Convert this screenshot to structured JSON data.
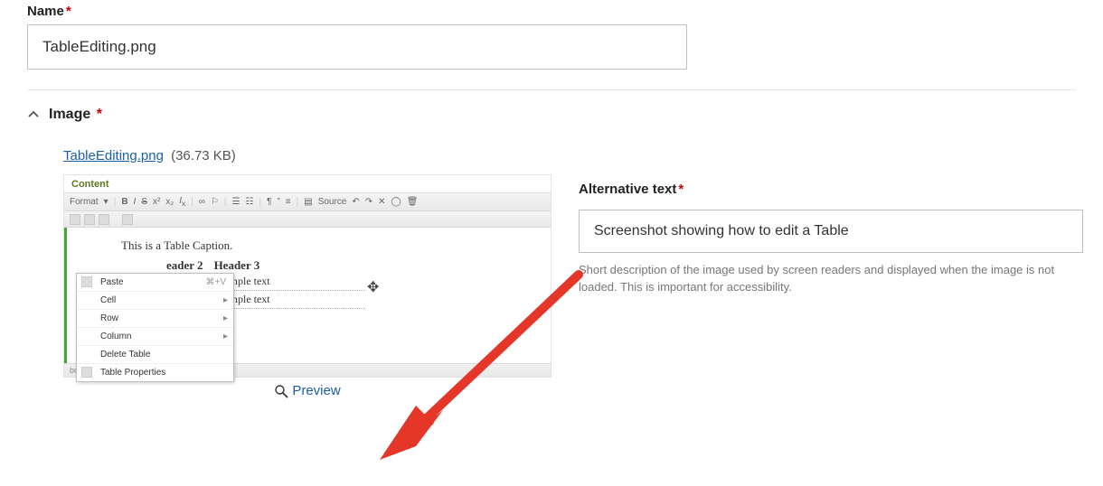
{
  "name_field": {
    "label": "Name",
    "value": "TableEditing.png"
  },
  "image_section": {
    "title": "Image",
    "file_name": "TableEditing.png",
    "file_size": "(36.73 KB)",
    "preview_label": "Preview"
  },
  "alt_text": {
    "label": "Alternative text",
    "value": "Screenshot showing how to edit a Table",
    "helper": "Short description of the image used by screen readers and displayed when the image is not loaded. This is important for accessibility."
  },
  "screenshot": {
    "panel_title": "Content",
    "format_label": "Format",
    "source_label": "Source",
    "caption": "This is a Table Caption.",
    "header2": "eader 2",
    "header3": "Header 3",
    "cell_a": "mple text",
    "cell_b": "Example text",
    "footer_path": "bo",
    "ctx_menu": {
      "paste": "Paste",
      "paste_shortcut": "⌘+V",
      "cell": "Cell",
      "row": "Row",
      "column": "Column",
      "delete_table": "Delete Table",
      "table_props": "Table Properties"
    }
  }
}
